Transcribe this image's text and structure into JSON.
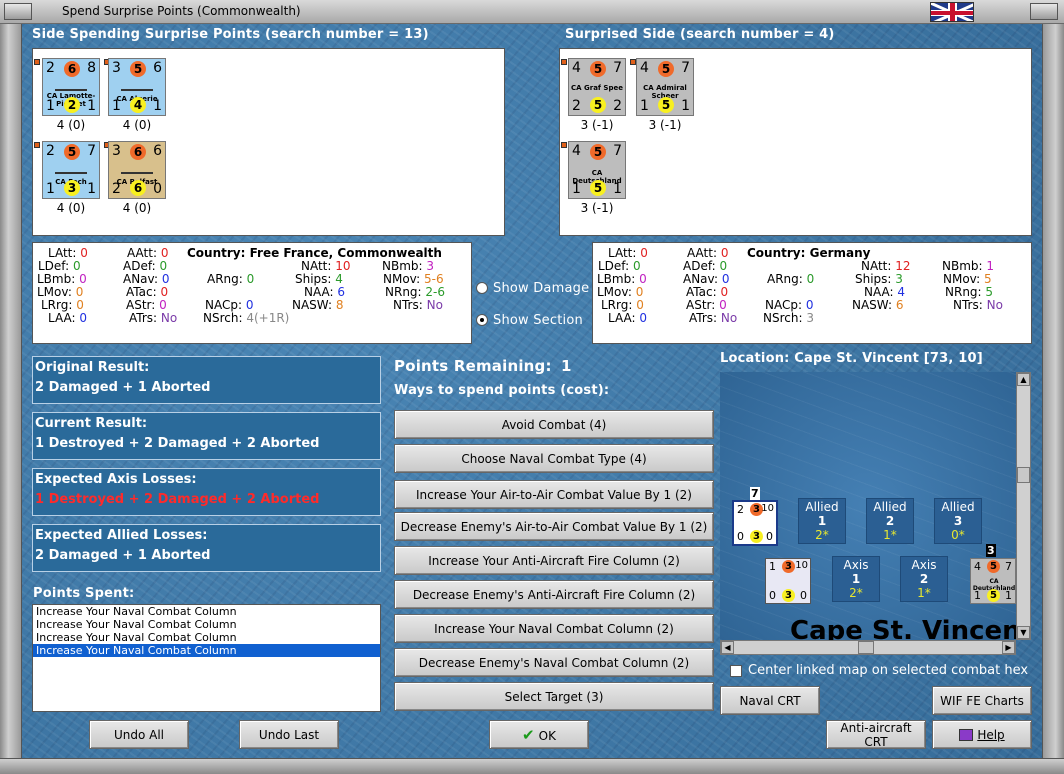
{
  "window": {
    "title": "Spend Surprise Points (Commonwealth)"
  },
  "spending": {
    "header": "Side Spending Surprise Points (search number = 13)",
    "units": [
      {
        "name": "CA Lamotte-Picquet",
        "tl": "2",
        "top": "6",
        "tr": "8",
        "bl": "1",
        "bottom": "2",
        "br": "1",
        "label": "4 (0)",
        "color": "blue"
      },
      {
        "name": "CA Algerie",
        "tl": "3",
        "top": "5",
        "tr": "6",
        "bl": "1",
        "bottom": "4",
        "br": "1",
        "label": "4 (0)",
        "color": "blue"
      },
      {
        "name": "CA Foch",
        "tl": "2",
        "top": "5",
        "tr": "7",
        "bl": "1",
        "bottom": "3",
        "br": "1",
        "label": "4 (0)",
        "color": "blue"
      },
      {
        "name": "CA Belfast",
        "tl": "3",
        "top": "6",
        "tr": "6",
        "bl": "2",
        "bottom": "6",
        "br": "0",
        "label": "4 (0)",
        "color": "tan"
      }
    ]
  },
  "surprised": {
    "header": "Surprised Side (search number = 4)",
    "units": [
      {
        "name": "CA Graf Spee",
        "tl": "4",
        "top": "5",
        "tr": "7",
        "bl": "2",
        "bottom": "5",
        "br": "2",
        "label": "3 (-1)",
        "color": "grey"
      },
      {
        "name": "CA Admiral Scheer",
        "tl": "4",
        "top": "5",
        "tr": "7",
        "bl": "1",
        "bottom": "5",
        "br": "1",
        "label": "3 (-1)",
        "color": "grey"
      },
      {
        "name": "CA Deutschland",
        "tl": "4",
        "top": "5",
        "tr": "7",
        "bl": "1",
        "bottom": "5",
        "br": "1",
        "label": "3 (-1)",
        "color": "grey"
      }
    ]
  },
  "stats_left": {
    "country_label": "Country:",
    "country": "Free France, Commonwealth",
    "LAtt": "0",
    "LDef": "0",
    "LBmb": "0",
    "LMov": "0",
    "LRrg": "0",
    "LAA": "0",
    "AAtt": "0",
    "ADef": "0",
    "ANav": "0",
    "ATac": "0",
    "AStr": "0",
    "ATrs": "No",
    "ARng": "0",
    "NACp": "0",
    "NSrch": "4(+1R)",
    "NAtt": "10",
    "Ships": "4",
    "NAA": "6",
    "NASW": "8",
    "NBmb": "3",
    "NMov": "5-6",
    "NRng": "2-6",
    "NTrs": "No"
  },
  "stats_right": {
    "country_label": "Country:",
    "country": "Germany",
    "LAtt": "0",
    "LDef": "0",
    "LBmb": "0",
    "LMov": "0",
    "LRrg": "0",
    "LAA": "0",
    "AAtt": "0",
    "ADef": "0",
    "ANav": "0",
    "ATac": "0",
    "AStr": "0",
    "ATrs": "No",
    "ARng": "0",
    "NACp": "0",
    "NSrch": "3",
    "NAtt": "12",
    "Ships": "3",
    "NAA": "4",
    "NASW": "6",
    "NBmb": "1",
    "NMov": "5",
    "NRng": "5",
    "NTrs": "No"
  },
  "options": {
    "show_damage": "Show Damage",
    "show_section": "Show Section"
  },
  "results": {
    "original_label": "Original Result:",
    "original": "2 Damaged + 1 Aborted",
    "current_label": "Current Result:",
    "current": "1 Destroyed + 2 Damaged + 2 Aborted",
    "axis_label": "Expected Axis Losses:",
    "axis": "1 Destroyed + 2 Damaged + 2 Aborted",
    "allied_label": "Expected Allied Losses:",
    "allied": "2 Damaged + 1 Aborted"
  },
  "points_spent": {
    "label": "Points Spent:",
    "items": [
      "Increase Your Naval Combat Column",
      "Increase Your Naval Combat Column",
      "Increase Your Naval Combat Column",
      "Increase Your Naval Combat Column"
    ]
  },
  "points": {
    "remaining_label": "Points Remaining:",
    "remaining": "1",
    "ways_label": "Ways to spend points (cost):"
  },
  "actions": [
    "Avoid Combat (4)",
    "Choose Naval Combat Type (4)",
    "Increase Your Air-to-Air Combat Value By 1 (2)",
    "Decrease Enemy's Air-to-Air Combat Value By 1 (2)",
    "Increase Your Anti-Aircraft Fire Column (2)",
    "Decrease Enemy's Anti-Aircraft Fire Column (2)",
    "Increase Your Naval Combat Column (2)",
    "Decrease Enemy's Naval Combat Column (2)",
    "Select Target (3)"
  ],
  "map": {
    "location": "Location: Cape St. Vincent [73, 10]",
    "place": "Cape St. Vincent",
    "boxes": [
      {
        "l1": "Allied",
        "l2": "1",
        "l3": "2*"
      },
      {
        "l1": "Allied",
        "l2": "2",
        "l3": "1*"
      },
      {
        "l1": "Allied",
        "l2": "3",
        "l3": "0*"
      },
      {
        "l1": "Axis",
        "l2": "1",
        "l3": "2*"
      },
      {
        "l1": "Axis",
        "l2": "2",
        "l3": "1*"
      }
    ],
    "stack1": {
      "count": "7",
      "tl": "2",
      "top": "3",
      "tr": "10",
      "bl": "0",
      "bottom": "3",
      "br": "0"
    },
    "stack2": {
      "tl": "1",
      "top": "3",
      "tr": "10",
      "bl": "0",
      "bottom": "3",
      "br": "0"
    },
    "stack3": {
      "count": "3",
      "tl": "4",
      "top": "5",
      "tr": "7",
      "name": "CA Deutschland",
      "bl": "1",
      "bottom": "5",
      "br": "1"
    },
    "center_label": "Center linked map on selected combat hex"
  },
  "buttons": {
    "undo_all": "Undo All",
    "undo_last": "Undo Last",
    "ok": "OK",
    "naval_crt": "Naval CRT",
    "wif_charts": "WIF FE Charts",
    "aa_crt": "Anti-aircraft CRT",
    "help": "Help"
  }
}
